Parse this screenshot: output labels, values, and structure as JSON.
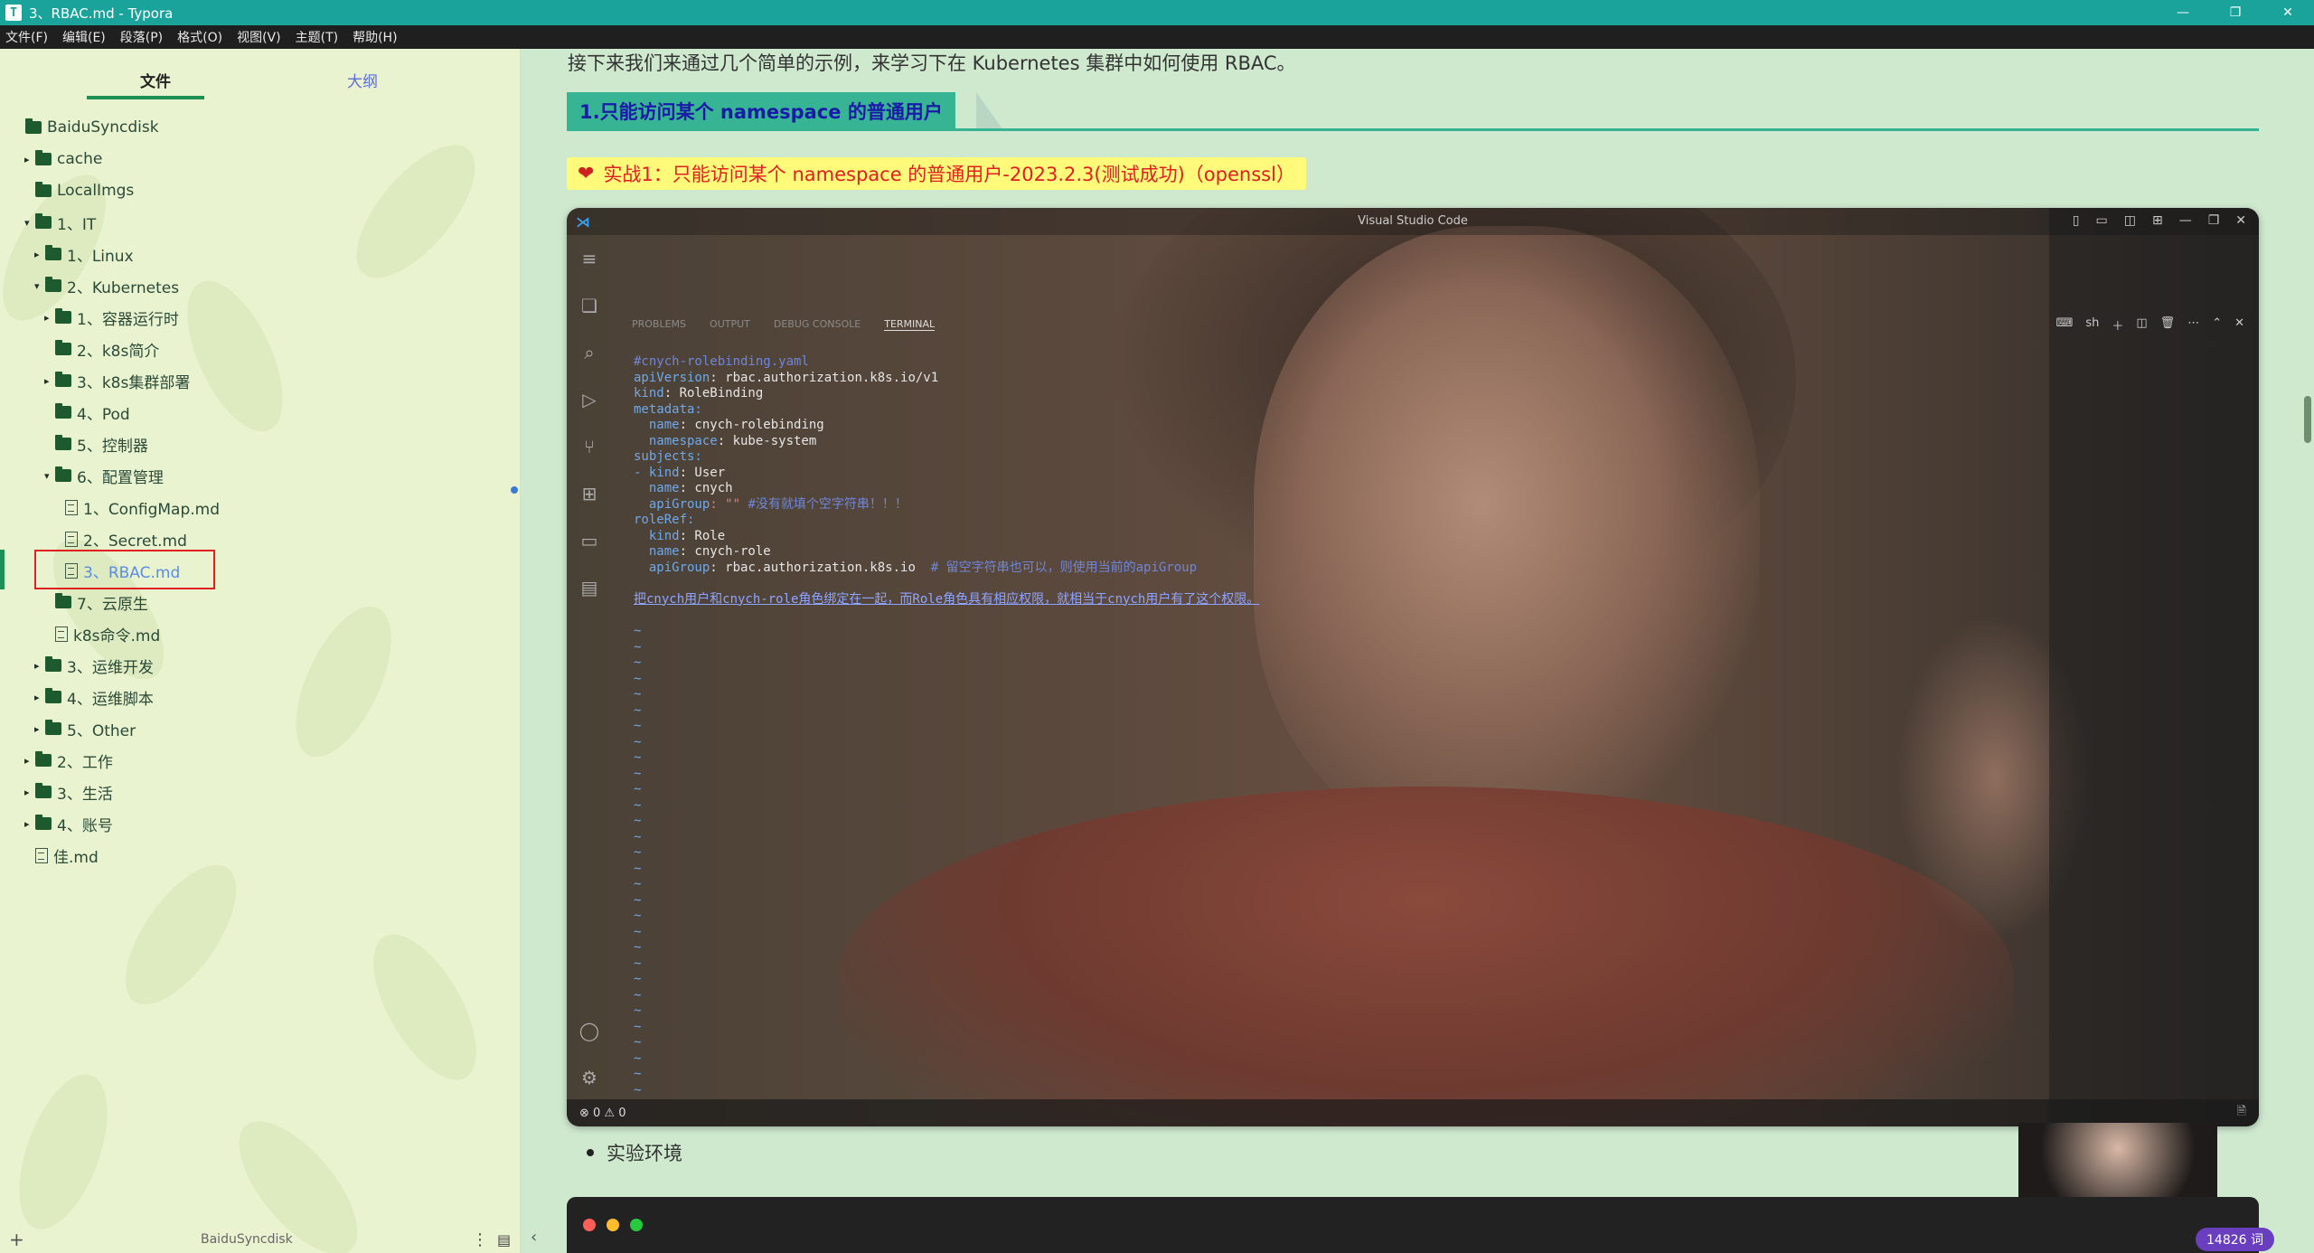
{
  "window": {
    "title": "3、RBAC.md - Typora",
    "app_icon": "T",
    "controls": [
      "—",
      "❐",
      "✕"
    ]
  },
  "menu": [
    "文件(F)",
    "编辑(E)",
    "段落(P)",
    "格式(O)",
    "视图(V)",
    "主题(T)",
    "帮助(H)"
  ],
  "sidebar": {
    "tabs": {
      "files": "文件",
      "outline": "大纲"
    },
    "footer_root": "BaiduSyncdisk",
    "tree": [
      {
        "label": "BaiduSyncdisk",
        "type": "folder",
        "depth": 0,
        "toggle": ""
      },
      {
        "label": "cache",
        "type": "folder",
        "depth": 1,
        "toggle": "▸"
      },
      {
        "label": "LocalImgs",
        "type": "folder",
        "depth": 1,
        "toggle": ""
      },
      {
        "label": "1、IT",
        "type": "folder",
        "depth": 1,
        "toggle": "▾"
      },
      {
        "label": "1、Linux",
        "type": "folder",
        "depth": 2,
        "toggle": "▸"
      },
      {
        "label": "2、Kubernetes",
        "type": "folder",
        "depth": 2,
        "toggle": "▾"
      },
      {
        "label": "1、容器运行时",
        "type": "folder",
        "depth": 3,
        "toggle": "▸"
      },
      {
        "label": "2、k8s简介",
        "type": "folder",
        "depth": 3,
        "toggle": ""
      },
      {
        "label": "3、k8s集群部署",
        "type": "folder",
        "depth": 3,
        "toggle": "▸"
      },
      {
        "label": "4、Pod",
        "type": "folder",
        "depth": 3,
        "toggle": ""
      },
      {
        "label": "5、控制器",
        "type": "folder",
        "depth": 3,
        "toggle": ""
      },
      {
        "label": "6、配置管理",
        "type": "folder",
        "depth": 3,
        "toggle": "▾"
      },
      {
        "label": "1、ConfigMap.md",
        "type": "file",
        "depth": 4,
        "toggle": ""
      },
      {
        "label": "2、Secret.md",
        "type": "file",
        "depth": 4,
        "toggle": ""
      },
      {
        "label": "3、RBAC.md",
        "type": "file",
        "depth": 4,
        "toggle": "",
        "active": true
      },
      {
        "label": "7、云原生",
        "type": "folder",
        "depth": 3,
        "toggle": ""
      },
      {
        "label": "k8s命令.md",
        "type": "file",
        "depth": 3,
        "toggle": ""
      },
      {
        "label": "3、运维开发",
        "type": "folder",
        "depth": 2,
        "toggle": "▸"
      },
      {
        "label": "4、运维脚本",
        "type": "folder",
        "depth": 2,
        "toggle": "▸"
      },
      {
        "label": "5、Other",
        "type": "folder",
        "depth": 2,
        "toggle": "▸"
      },
      {
        "label": "2、工作",
        "type": "folder",
        "depth": 1,
        "toggle": "▸"
      },
      {
        "label": "3、生活",
        "type": "folder",
        "depth": 1,
        "toggle": "▸"
      },
      {
        "label": "4、账号",
        "type": "folder",
        "depth": 1,
        "toggle": "▸"
      },
      {
        "label": "佳.md",
        "type": "file",
        "depth": 1,
        "toggle": ""
      }
    ]
  },
  "editor": {
    "intro": "接下来我们来通过几个简单的示例，来学习下在 Kubernetes 集群中如何使用 RBAC。",
    "heading": "1.只能访问某个 namespace 的普通用户",
    "callout": "实战1：只能访问某个 namespace 的普通用户-2023.2.3(测试成功)（openssl）",
    "bullet": "实验环境",
    "word_count": "14826 词"
  },
  "vscode": {
    "title": "Visual Studio Code",
    "tabs": [
      "PROBLEMS",
      "OUTPUT",
      "DEBUG CONSOLE",
      "TERMINAL"
    ],
    "shell": "sh",
    "status": "⊗ 0 ⚠ 0",
    "code": {
      "l1": "#cnych-rolebinding.yaml",
      "l2k": "apiVersion",
      "l2v": ": rbac.authorization.k8s.io/v1",
      "l3k": "kind",
      "l3v": ": RoleBinding",
      "l4k": "metadata:",
      "l5k": "  name",
      "l5v": ": cnych-rolebinding",
      "l6k": "  namespace",
      "l6v": ": kube-system",
      "l7k": "subjects:",
      "l8k": "- kind",
      "l8v": ": User",
      "l9k": "  name",
      "l9v": ": cnych",
      "l10k": "  apiGroup",
      "l10s": ": \"\"",
      "l10c": " #没有就填个空字符串！！！",
      "l11k": "roleRef:",
      "l12k": "  kind",
      "l12v": ": Role",
      "l13k": "  name",
      "l13v": ": cnych-role",
      "l14k": "  apiGroup",
      "l14v": ": rbac.authorization.k8s.io",
      "l14c": "  # 留空字符串也可以，则使用当前的apiGroup",
      "l15": "把cnych用户和cnych-role角色绑定在一起，而Role角色具有相应权限，就相当于cnych用户有了这个权限。"
    }
  }
}
